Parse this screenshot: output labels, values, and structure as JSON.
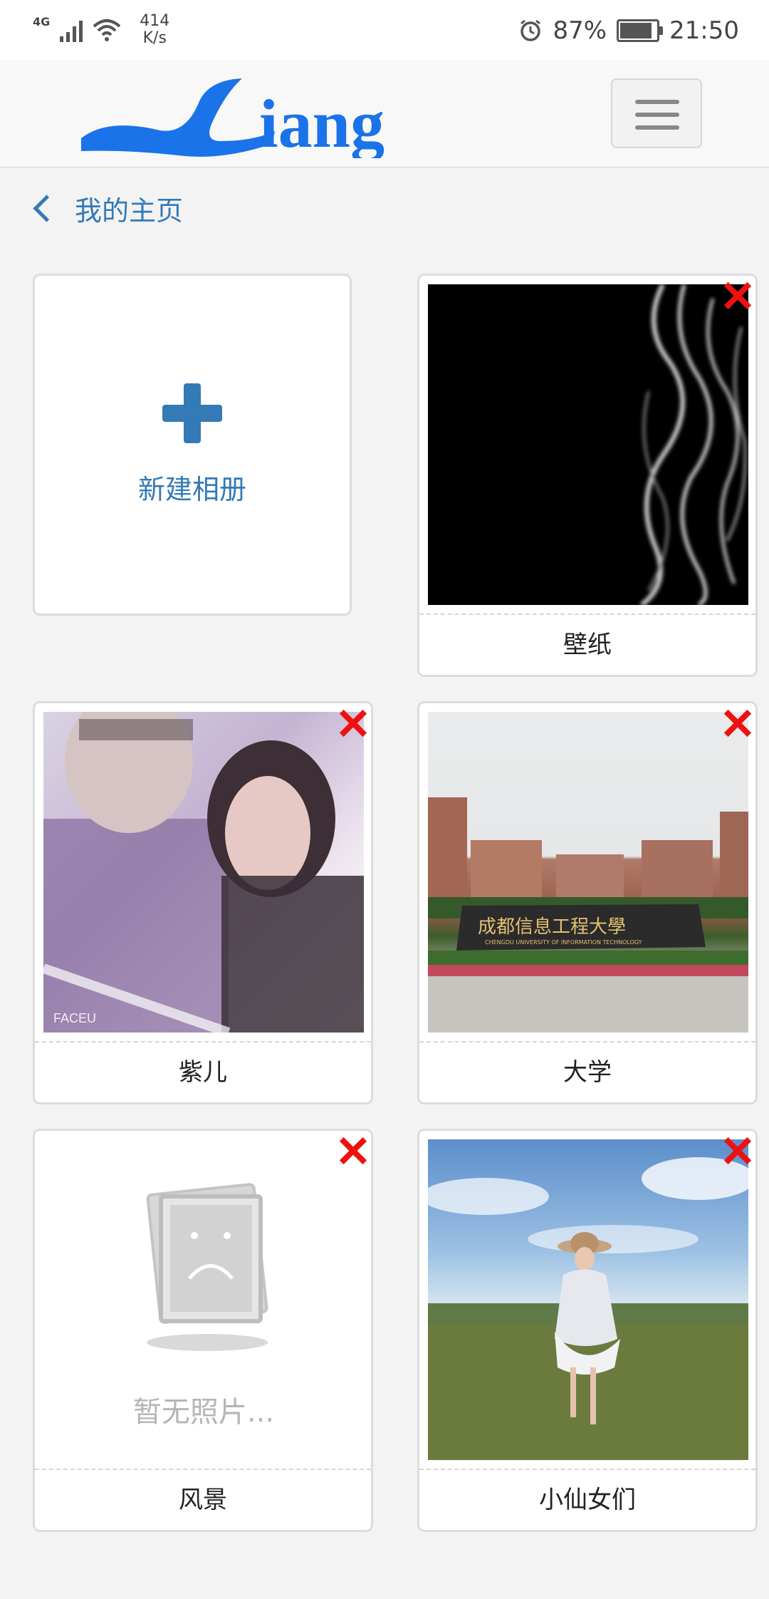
{
  "status_bar": {
    "network": "4G",
    "speed_value": "414",
    "speed_unit": "K/s",
    "battery_percent": "87%",
    "battery_level": 0.87,
    "time": "21:50"
  },
  "navbar": {
    "logo_text": "Liang",
    "logo_color": "#1a73e8"
  },
  "breadcrumb": {
    "back_label": "我的主页"
  },
  "new_album": {
    "label": "新建相册"
  },
  "albums": [
    {
      "name": "壁纸",
      "has_photo": true
    },
    {
      "name": "紫儿",
      "has_photo": true
    },
    {
      "name": "大学",
      "has_photo": true
    },
    {
      "name": "风景",
      "has_photo": false,
      "empty_text": "暂无照片..."
    },
    {
      "name": "小仙女们",
      "has_photo": true
    }
  ],
  "photo_texts": {
    "university_sign": "成都信息工程大學",
    "university_sign_en": "CHENGDU UNIVERSITY OF INFORMATION TECHNOLOGY",
    "watermark": "FACEU"
  },
  "colors": {
    "accent": "#337ab7",
    "delete": "#ee1111",
    "background": "#f3f3f3"
  },
  "icons": {
    "back": "chevron-left-icon",
    "menu": "hamburger-icon",
    "add": "plus-icon",
    "delete": "close-icon"
  }
}
